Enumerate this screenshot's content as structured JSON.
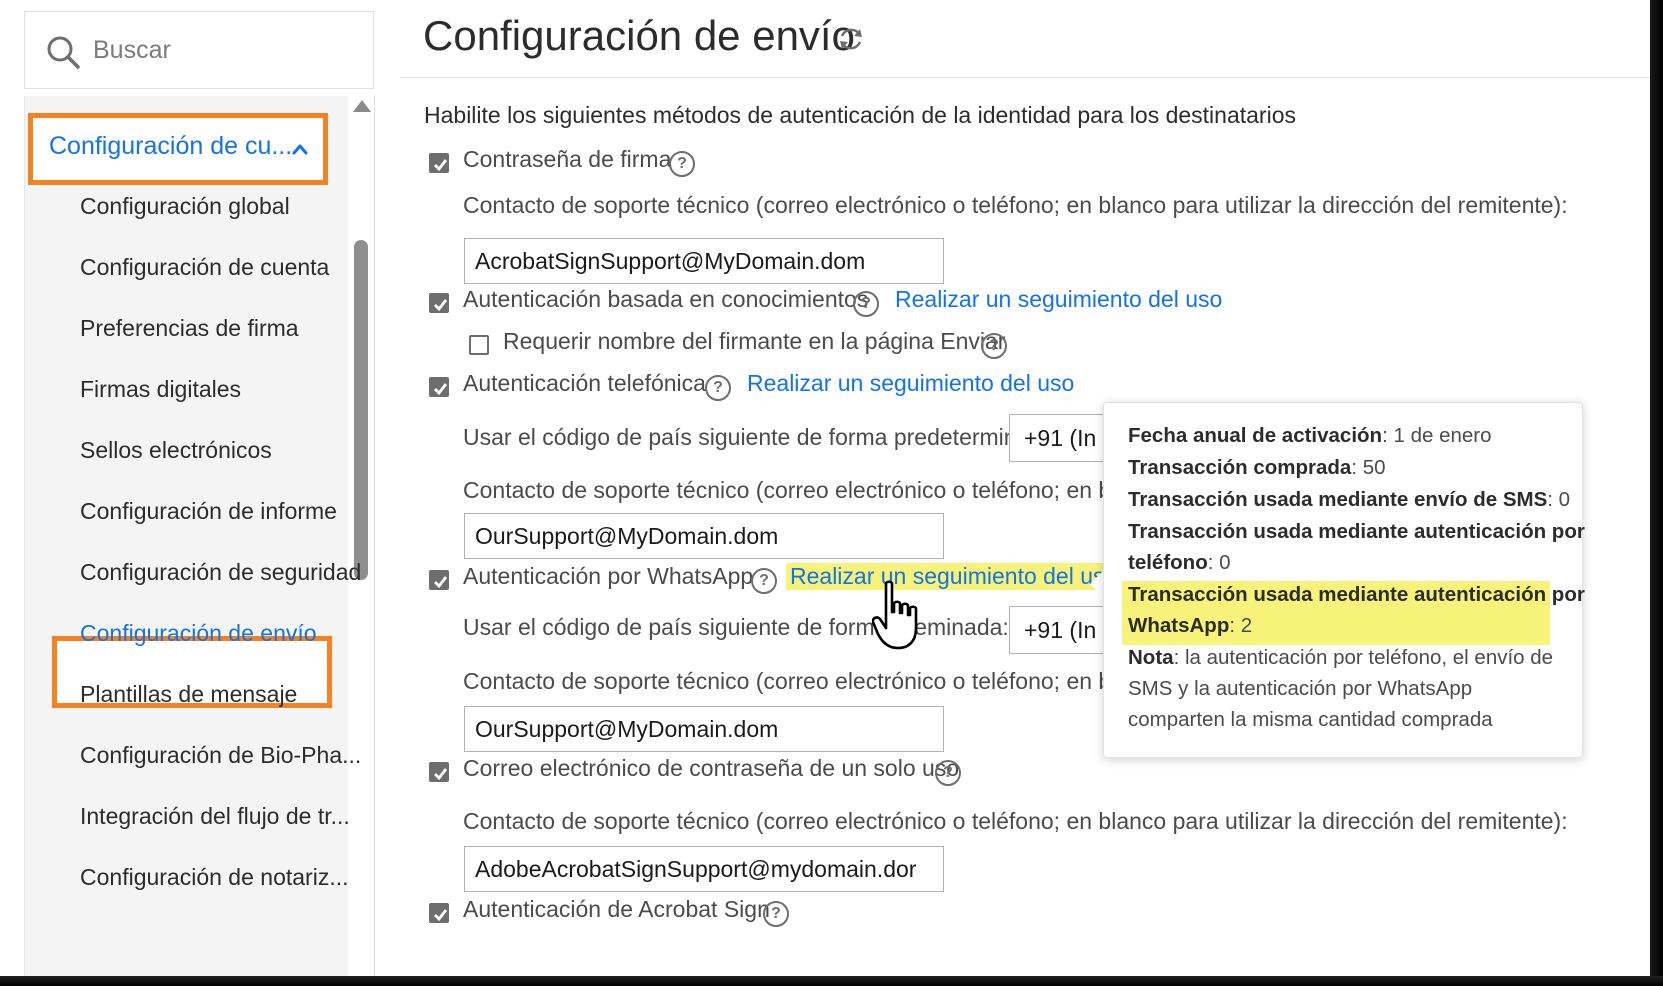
{
  "search": {
    "placeholder": "Buscar",
    "icon": "search-icon"
  },
  "sidebar": {
    "section_label": "Configuración de cu...",
    "items": [
      "Configuración global",
      "Configuración de cuenta",
      "Preferencias de firma",
      "Firmas digitales",
      "Sellos electrónicos",
      "Configuración de informe",
      "Configuración de seguridad",
      "Configuración de envío",
      "Plantillas de mensaje",
      "Configuración de Bio-Pha...",
      "Integración del flujo de tr...",
      "Configuración de notariz..."
    ],
    "active_item": "Configuración de envío"
  },
  "main": {
    "title": "Configuración de envío",
    "heading": "Habilite los siguientes métodos de autenticación de la identidad para los destinatarios",
    "support_label": "Contacto de soporte técnico (correo electrónico o teléfono; en blanco para utilizar la dirección del remitente):",
    "support_label_truncated": "Contacto de soporte técnico (correo electrónico o teléfono; en blanc",
    "country_label": "Usar el código de país siguiente de forma predeterminada:",
    "country_label_partial_a": "Usar el código de país siguiente de forma pre",
    "country_label_partial_b": "minada:",
    "track_usage": "Realizar un seguimiento del uso",
    "track_usage_truncated": "Realizar un seguimiento del uso",
    "help_glyph": "?",
    "methods": {
      "password": {
        "label": "Contraseña de firma",
        "checked": true,
        "support_value": "AcrobatSignSupport@MyDomain.dom"
      },
      "kba": {
        "label": "Autenticación basada en conocimientos",
        "checked": true
      },
      "kba_require_name": {
        "label": "Requerir nombre del firmante en la página Enviar",
        "checked": false
      },
      "phone": {
        "label": "Autenticación telefónica",
        "checked": true,
        "country_value": "+91 (In",
        "support_value": "OurSupport@MyDomain.dom"
      },
      "whatsapp": {
        "label": "Autenticación por WhatsApp",
        "checked": true,
        "country_value": "+91 (In",
        "support_value": "OurSupport@MyDomain.dom"
      },
      "otp_email": {
        "label": "Correo electrónico de contraseña de un solo uso",
        "checked": true,
        "support_value": "AdobeAcrobatSignSupport@mydomain.dor"
      },
      "acrobat_sign": {
        "label": "Autenticación de Acrobat Sign",
        "checked": true
      }
    }
  },
  "tooltip": {
    "activation_label": "Fecha anual de activación",
    "activation_value": ": 1 de enero",
    "purchased_label": "Transacción comprada",
    "purchased_value": ": 50",
    "sms_label": "Transacción usada mediante envío de SMS",
    "sms_value": ": 0",
    "phone_label_1": "Transacción usada mediante autenticación por",
    "phone_label_2": "teléfono",
    "phone_value": ": 0",
    "wa_label_1": "Transacción usada mediante autenticación por",
    "wa_label_2": "WhatsApp",
    "wa_value": ": 2",
    "note_label": "Nota",
    "note_line_1": ": la autenticación por teléfono, el envío de",
    "note_line_2": "SMS y la autenticación por WhatsApp",
    "note_line_3": "comparten la misma cantidad comprada"
  },
  "colors": {
    "accent": "#1473e6",
    "highlight_box": "#f58220",
    "marker": "#f6f27a"
  }
}
